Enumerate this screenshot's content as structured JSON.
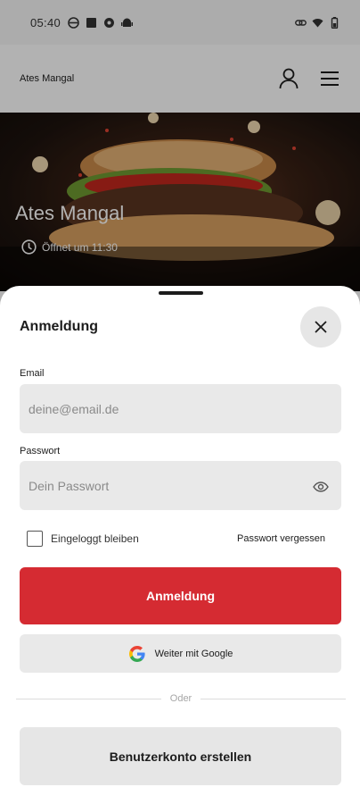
{
  "status_bar": {
    "time": "05:40"
  },
  "header": {
    "brand": "Ates Mangal",
    "icons": [
      "user-icon",
      "menu-icon"
    ]
  },
  "hero": {
    "title": "Ates Mangal",
    "opening": "Öffnet um 11:30"
  },
  "login_sheet": {
    "title": "Anmeldung",
    "email_label": "Email",
    "email_placeholder": "deine@email.de",
    "email_value": "",
    "password_label": "Passwort",
    "password_placeholder": "Dein Passwort",
    "password_value": "",
    "remember_label": "Eingeloggt bleiben",
    "remember_checked": false,
    "forgot_label": "Passwort vergessen",
    "submit_label": "Anmeldung",
    "google_label": "Weiter mit Google",
    "divider_label": "Oder",
    "create_account_label": "Benutzerkonto erstellen"
  },
  "colors": {
    "primary": "#d52b32",
    "field_bg": "#e9e9e9"
  }
}
